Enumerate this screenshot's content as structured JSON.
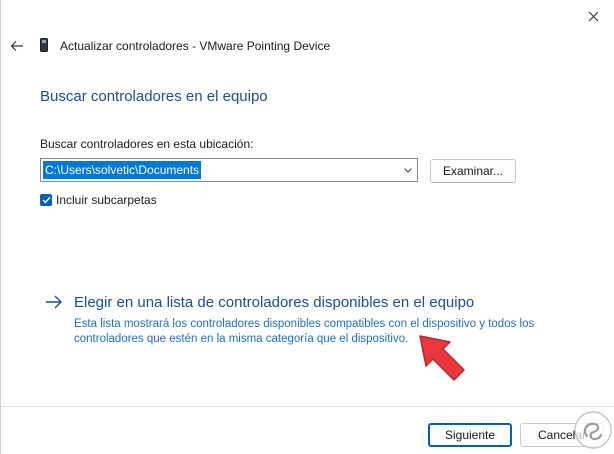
{
  "window": {
    "title": "Actualizar controladores - VMware Pointing Device"
  },
  "main": {
    "heading": "Buscar controladores en el equipo",
    "path_label": "Buscar controladores en esta ubicación:",
    "path_value": "C:\\Users\\solvetic\\Documents",
    "browse_label": "Examinar...",
    "include_subfolders_label": "Incluir subcarpetas",
    "include_subfolders_checked": true
  },
  "link": {
    "title": "Elegir en una lista de controladores disponibles en el equipo",
    "description": "Esta lista mostrará los controladores disponibles compatibles con el dispositivo y todos los controladores que estén en la misma categoría que el dispositivo."
  },
  "footer": {
    "next_label": "Siguiente",
    "cancel_label": "Cancelar"
  },
  "icons": {
    "close": "close-icon",
    "back": "back-arrow-icon",
    "device": "device-icon",
    "dropdown": "chevron-down-icon",
    "check": "checkmark-icon",
    "link_arrow": "right-arrow-icon",
    "pointer": "pointer-arrow-icon",
    "logo": "watermark-logo-icon"
  },
  "colors": {
    "accent": "#005fb8",
    "heading": "#1f4e8c",
    "link_desc": "#1f6ec6",
    "selection": "#0078d7",
    "pointer": "#e8383d"
  }
}
